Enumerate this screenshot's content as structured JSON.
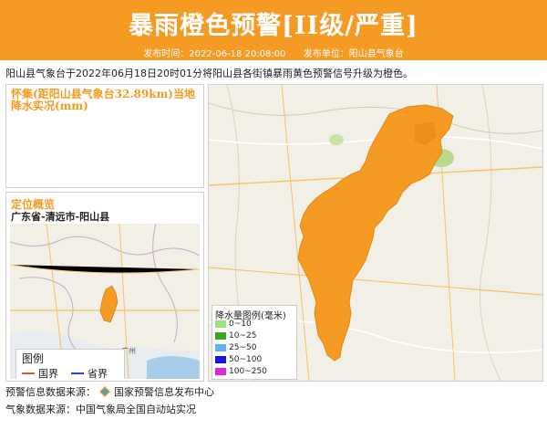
{
  "header": {
    "title": "暴雨橙色预警[II级/严重]",
    "publish_time": "发布时间：2022-06-18 20:08:00",
    "publisher": "发布单位：阳山县气象台"
  },
  "description": "阳山县气象台于2022年06月18日20时01分将阳山县各街镇暴雨黄色预警信号升级为橙色。",
  "rain_panel": {
    "title": "怀集(距阳山县气象台32.89km)当地降水实况(mm)"
  },
  "location_panel": {
    "title": "定位概览",
    "region": "广东省-清远市-阳山县",
    "legend_title": "图例",
    "legend_items": [
      {
        "label": "国界",
        "color": "#d9534f"
      },
      {
        "label": "省界",
        "color": "#1f4fbf"
      }
    ]
  },
  "map": {
    "warning_color": "#f59a23",
    "city_labels": [
      "广州"
    ]
  },
  "rain_legend": {
    "title": "降水量图例(毫米)",
    "items": [
      {
        "label": "0~10",
        "color": "#9be37e"
      },
      {
        "label": "10~25",
        "color": "#3aa626"
      },
      {
        "label": "25~50",
        "color": "#5fb3f0"
      },
      {
        "label": "50~100",
        "color": "#1616e0"
      },
      {
        "label": "100~250",
        "color": "#e026d8"
      }
    ]
  },
  "footer": {
    "source_prefix": "预警信息数据来源：",
    "source_name": "国家预警信息发布中心",
    "weather_source": "气象数据来源：中国气象局全国自动站实况"
  }
}
